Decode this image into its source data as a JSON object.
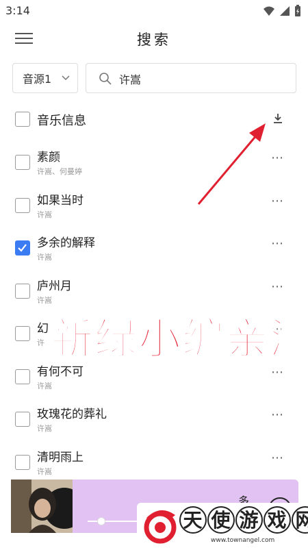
{
  "status_bar": {
    "time": "3:14",
    "icons": [
      "wifi-icon",
      "signal-icon",
      "battery-icon"
    ]
  },
  "app_bar": {
    "title": "搜索",
    "menu_icon": "hamburger-menu-icon"
  },
  "search": {
    "source_label": "音源1",
    "query": "许嵩",
    "search_icon": "search-icon"
  },
  "list_header": {
    "label": "音乐信息",
    "download_icon": "download-icon"
  },
  "songs": [
    {
      "title": "素颜",
      "artist": "许嵩、何曼婷",
      "checked": false
    },
    {
      "title": "如果当时",
      "artist": "许嵩",
      "checked": false
    },
    {
      "title": "多余的解释",
      "artist": "许嵩",
      "checked": true
    },
    {
      "title": "庐州月",
      "artist": "许嵩",
      "checked": false
    },
    {
      "title": "幻",
      "artist": "许",
      "checked": false
    },
    {
      "title": "有何不可",
      "artist": "许嵩",
      "checked": false
    },
    {
      "title": "玫瑰花的葬礼",
      "artist": "许嵩",
      "checked": false
    },
    {
      "title": "清明雨上",
      "artist": "许嵩",
      "checked": false
    }
  ],
  "more_label": "⋯",
  "player": {
    "title": "多",
    "progress": 0.13
  },
  "overlay": {
    "text": "新绿小编亲测"
  },
  "watermark": {
    "chars": [
      "天",
      "使",
      "游",
      "戏",
      "网"
    ],
    "url": "www.townangel.com"
  },
  "colors": {
    "accent": "#3b7cf3",
    "player_bg": "#e1c2f2",
    "overlay_red": "#e52233",
    "arrow_red": "#e02030"
  }
}
